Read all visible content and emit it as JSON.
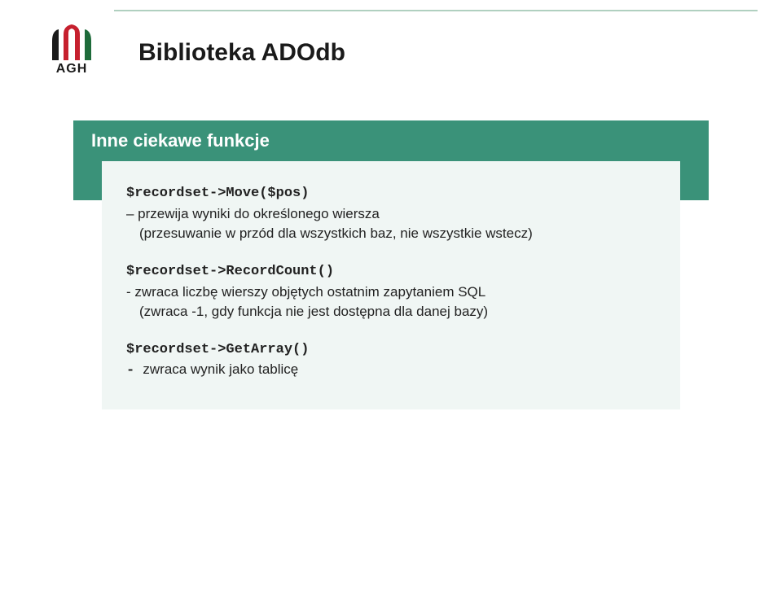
{
  "logo": {
    "text": "AGH"
  },
  "title": "Biblioteka ADOdb",
  "subtitle": "Inne ciekawe funkcje",
  "blocks": {
    "b1": {
      "code": "$recordset->Move($pos)",
      "line1": "– przewija wyniki do określonego wiersza",
      "line2": "(przesuwanie w przód dla wszystkich baz, nie wszystkie wstecz)"
    },
    "b2": {
      "code": "$recordset->RecordCount()",
      "line1": "- zwraca liczbę wierszy objętych ostatnim zapytaniem SQL",
      "line2": "(zwraca -1,  gdy funkcja nie jest dostępna dla danej bazy)"
    },
    "b3": {
      "code": "$recordset->GetArray()",
      "dash": "- ",
      "line1": "zwraca wynik jako tablicę"
    }
  }
}
